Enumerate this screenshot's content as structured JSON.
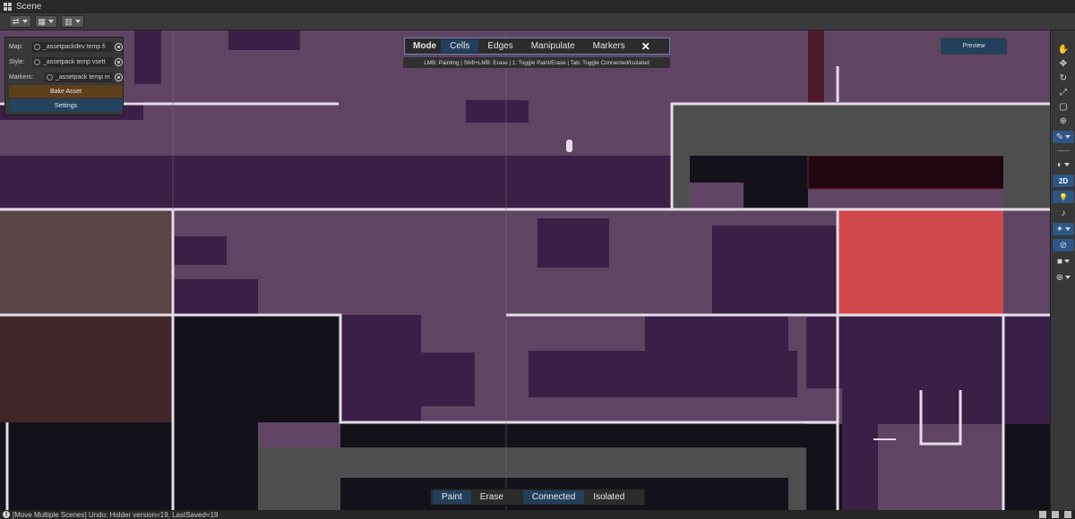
{
  "window": {
    "title": "Scene"
  },
  "toolbar": {
    "buttons": [
      {
        "icon": "transform-gizmo-icon",
        "glyph": "⇄"
      },
      {
        "icon": "grid-snap-icon",
        "glyph": "▦"
      },
      {
        "icon": "visibility-toggle-icon",
        "glyph": "▥"
      }
    ]
  },
  "panel": {
    "map_label": "Map:",
    "map_value": "_assetpackdev temp fi",
    "style_label": "Style:",
    "style_value": "_assetpack temp vsett",
    "markers_label": "Markers:",
    "markers_value": "_assetpack temp m",
    "bake_label": "Bake Asset",
    "settings_label": "Settings"
  },
  "modebar": {
    "label": "Mode",
    "tabs": [
      "Cells",
      "Edges",
      "Manipulate",
      "Markers"
    ],
    "active_tab": "Cells",
    "close": "✕"
  },
  "hint": "LMB: Painting | Shift+LMB: Erase | 1: Toggle Paint/Erase | Tab: Toggle Connected/Isolated",
  "preview_label": "Preview",
  "paintbar": {
    "tabs": [
      "Paint",
      "Erase",
      "Connected",
      "Isolated"
    ],
    "active": [
      "Paint",
      "Connected"
    ]
  },
  "tools": [
    {
      "name": "hand-tool-icon",
      "glyph": "✋"
    },
    {
      "name": "move-tool-icon",
      "glyph": "✥"
    },
    {
      "name": "rotate-tool-icon",
      "glyph": "↻"
    },
    {
      "name": "scale-tool-icon",
      "glyph": "⤢"
    },
    {
      "name": "rect-tool-icon",
      "glyph": "▢"
    },
    {
      "name": "transform-tool-icon",
      "glyph": "⊕"
    },
    {
      "name": "brush-tool-icon",
      "glyph": "✎"
    }
  ],
  "view_tools": [
    {
      "name": "shading-mode-icon",
      "glyph": "◐"
    },
    {
      "name": "2d-toggle",
      "glyph": "2D"
    },
    {
      "name": "lighting-toggle-icon",
      "glyph": "💡"
    },
    {
      "name": "audio-toggle-icon",
      "glyph": "♪"
    },
    {
      "name": "effects-toggle-icon",
      "glyph": "✦"
    },
    {
      "name": "hidden-objects-icon",
      "glyph": "⊘"
    },
    {
      "name": "camera-icon",
      "glyph": "■"
    },
    {
      "name": "gizmos-icon",
      "glyph": "⊛"
    }
  ],
  "statusbar": {
    "message": "[Move Multiple Scenes] Undo: Holder version=19, LastSaved=19"
  },
  "colors": {
    "light_purple": "#5f4563",
    "dark_purple": "#3a1f47",
    "near_black": "#13121a",
    "gray": "#4e4e4e",
    "brown": "#5a4445",
    "dark_brown": "#3f2628",
    "red": "#d04a4d",
    "white_lines": "#e6dce8"
  }
}
